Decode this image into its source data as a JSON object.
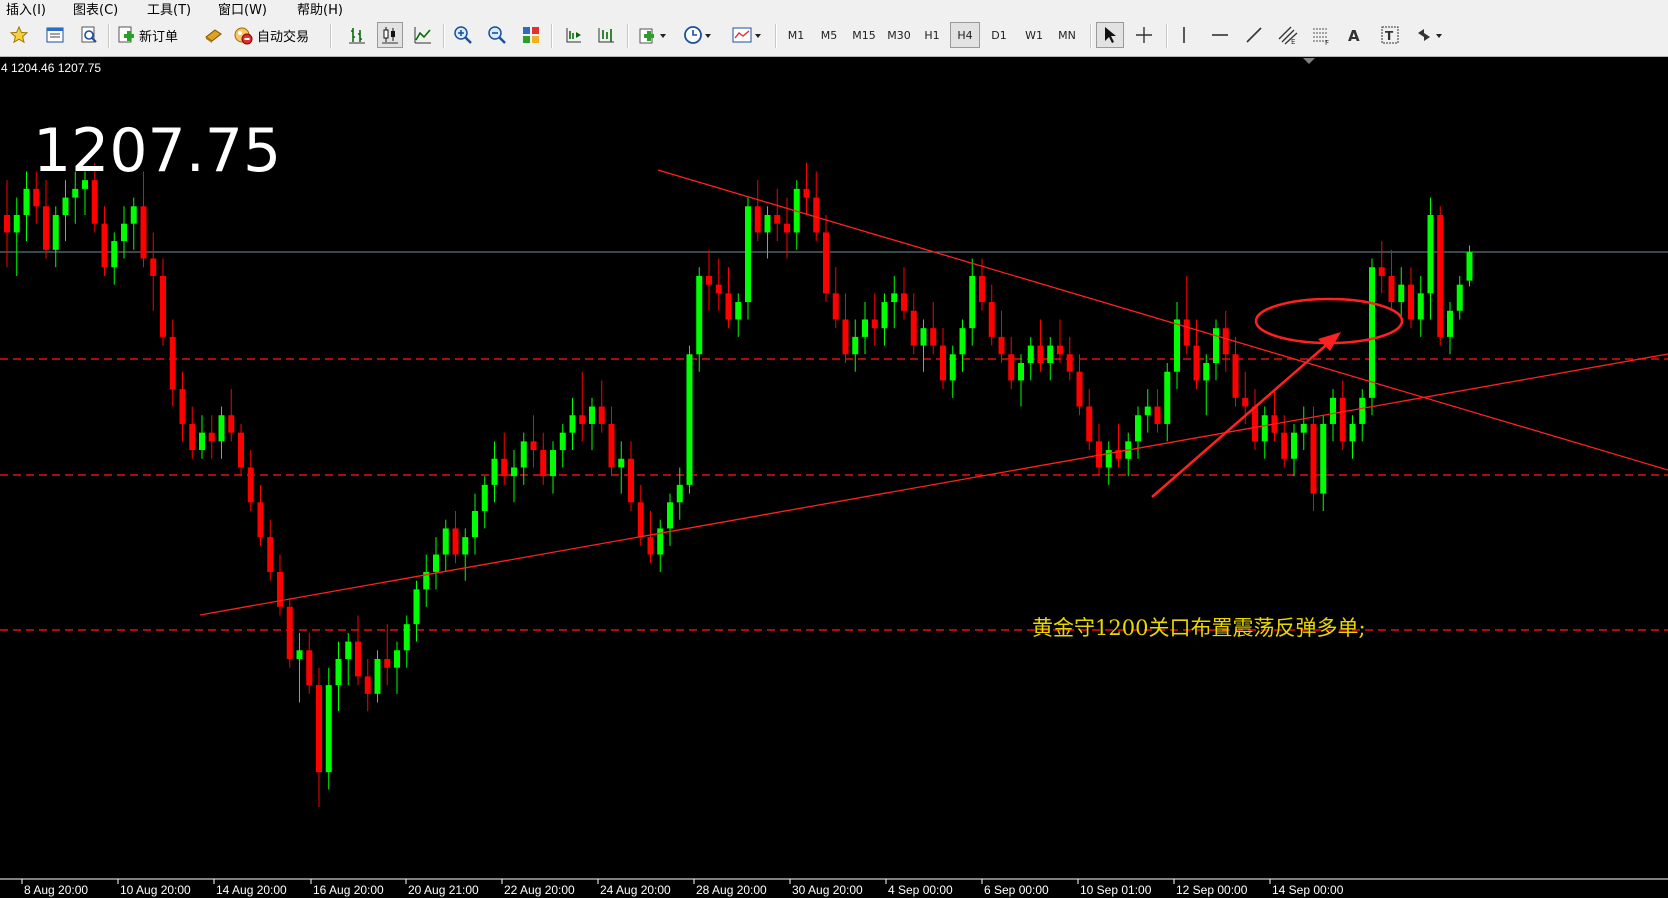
{
  "menu": {
    "items": [
      {
        "label": "插入(I)"
      },
      {
        "label": "图表(C)"
      },
      {
        "label": "工具(T)"
      },
      {
        "label": "窗口(W)"
      },
      {
        "label": "帮助(H)"
      }
    ]
  },
  "toolbar": {
    "new_order_label": "新订单",
    "auto_trading_label": "自动交易",
    "timeframes": [
      "M1",
      "M5",
      "M15",
      "M30",
      "H1",
      "H4",
      "D1",
      "W1",
      "MN"
    ],
    "active_timeframe": "H4"
  },
  "chart_header": {
    "ohlc_text": "4 1204.46 1207.75"
  },
  "price_display": "1207.75",
  "annotation": {
    "text": "黄金守1200关口布置震荡反弹多单;"
  },
  "colors": {
    "background": "#000000",
    "bull_candle": "#00ff00",
    "bear_candle": "#ff0000",
    "trend_line": "#ff2020",
    "bid_line": "#6f8f99",
    "annotation_text": "#e8d800"
  },
  "chart_data": {
    "type": "candlestick",
    "x_tick_labels": [
      "8 Aug 20:00",
      "10 Aug 20:00",
      "14 Aug 20:00",
      "16 Aug 20:00",
      "20 Aug 21:00",
      "22 Aug 20:00",
      "24 Aug 20:00",
      "28 Aug 20:00",
      "30 Aug 20:00",
      "4 Sep 00:00",
      "6 Sep 00:00",
      "10 Sep 01:00",
      "12 Sep 00:00",
      "14 Sep 00:00"
    ],
    "last_price": 1207.75,
    "horizontal_levels_dashed": 3,
    "candles": [
      [
        1212,
        1216,
        1206,
        1210
      ],
      [
        1210,
        1214,
        1205,
        1212
      ],
      [
        1212,
        1217,
        1209,
        1215
      ],
      [
        1215,
        1217,
        1211,
        1213
      ],
      [
        1213,
        1216,
        1207,
        1208
      ],
      [
        1208,
        1213,
        1206,
        1212
      ],
      [
        1212,
        1216,
        1209,
        1214
      ],
      [
        1214,
        1217,
        1211,
        1215
      ],
      [
        1215,
        1217,
        1212,
        1216
      ],
      [
        1216,
        1218,
        1210,
        1211
      ],
      [
        1211,
        1213,
        1205,
        1206
      ],
      [
        1206,
        1210,
        1204,
        1209
      ],
      [
        1209,
        1213,
        1207,
        1211
      ],
      [
        1211,
        1214,
        1208,
        1213
      ],
      [
        1213,
        1217,
        1206,
        1207
      ],
      [
        1207,
        1210,
        1201,
        1205
      ],
      [
        1205,
        1207,
        1197,
        1198
      ],
      [
        1198,
        1200,
        1190,
        1192
      ],
      [
        1192,
        1194,
        1186,
        1188
      ],
      [
        1188,
        1190,
        1184,
        1185
      ],
      [
        1185,
        1189,
        1184,
        1187
      ],
      [
        1187,
        1189,
        1184,
        1186
      ],
      [
        1186,
        1190,
        1184,
        1189
      ],
      [
        1189,
        1192,
        1186,
        1187
      ],
      [
        1187,
        1188,
        1182,
        1183
      ],
      [
        1183,
        1185,
        1178,
        1179
      ],
      [
        1179,
        1181,
        1174,
        1175
      ],
      [
        1175,
        1177,
        1170,
        1171
      ],
      [
        1171,
        1173,
        1166,
        1167
      ],
      [
        1167,
        1168,
        1160,
        1161
      ],
      [
        1161,
        1164,
        1156,
        1162
      ],
      [
        1162,
        1164,
        1157,
        1158
      ],
      [
        1158,
        1160,
        1144,
        1148
      ],
      [
        1148,
        1160,
        1146,
        1158
      ],
      [
        1158,
        1163,
        1155,
        1161
      ],
      [
        1161,
        1164,
        1158,
        1163
      ],
      [
        1163,
        1166,
        1158,
        1159
      ],
      [
        1159,
        1161,
        1155,
        1157
      ],
      [
        1157,
        1162,
        1156,
        1161
      ],
      [
        1161,
        1165,
        1158,
        1160
      ],
      [
        1160,
        1163,
        1157,
        1162
      ],
      [
        1162,
        1166,
        1160,
        1165
      ],
      [
        1165,
        1170,
        1163,
        1169
      ],
      [
        1169,
        1173,
        1167,
        1171
      ],
      [
        1171,
        1175,
        1169,
        1173
      ],
      [
        1173,
        1177,
        1171,
        1176
      ],
      [
        1176,
        1178,
        1172,
        1173
      ],
      [
        1173,
        1176,
        1170,
        1175
      ],
      [
        1175,
        1180,
        1173,
        1178
      ],
      [
        1178,
        1182,
        1176,
        1181
      ],
      [
        1181,
        1186,
        1179,
        1184
      ],
      [
        1184,
        1187,
        1181,
        1182
      ],
      [
        1182,
        1185,
        1179,
        1183
      ],
      [
        1183,
        1187,
        1181,
        1186
      ],
      [
        1186,
        1189,
        1183,
        1185
      ],
      [
        1185,
        1187,
        1181,
        1182
      ],
      [
        1182,
        1186,
        1180,
        1185
      ],
      [
        1185,
        1188,
        1183,
        1187
      ],
      [
        1187,
        1191,
        1185,
        1189
      ],
      [
        1189,
        1194,
        1186,
        1188
      ],
      [
        1188,
        1191,
        1185,
        1190
      ],
      [
        1190,
        1193,
        1187,
        1188
      ],
      [
        1188,
        1190,
        1182,
        1183
      ],
      [
        1183,
        1186,
        1180,
        1184
      ],
      [
        1184,
        1186,
        1178,
        1179
      ],
      [
        1179,
        1181,
        1174,
        1175
      ],
      [
        1175,
        1178,
        1172,
        1173
      ],
      [
        1173,
        1177,
        1171,
        1176
      ],
      [
        1176,
        1180,
        1174,
        1179
      ],
      [
        1179,
        1183,
        1177,
        1181
      ],
      [
        1181,
        1197,
        1180,
        1196
      ],
      [
        1196,
        1206,
        1194,
        1205
      ],
      [
        1205,
        1208,
        1201,
        1204
      ],
      [
        1204,
        1207,
        1201,
        1203
      ],
      [
        1203,
        1206,
        1199,
        1200
      ],
      [
        1200,
        1203,
        1198,
        1202
      ],
      [
        1202,
        1214,
        1200,
        1213
      ],
      [
        1213,
        1216,
        1209,
        1210
      ],
      [
        1210,
        1213,
        1207,
        1212
      ],
      [
        1212,
        1215,
        1209,
        1211
      ],
      [
        1211,
        1214,
        1207,
        1210
      ],
      [
        1210,
        1216,
        1208,
        1215
      ],
      [
        1215,
        1218,
        1212,
        1214
      ],
      [
        1214,
        1217,
        1209,
        1210
      ],
      [
        1210,
        1212,
        1202,
        1203
      ],
      [
        1203,
        1206,
        1199,
        1200
      ],
      [
        1200,
        1203,
        1195,
        1196
      ],
      [
        1196,
        1200,
        1194,
        1198
      ],
      [
        1198,
        1202,
        1196,
        1200
      ],
      [
        1200,
        1203,
        1197,
        1199
      ],
      [
        1199,
        1203,
        1197,
        1202
      ],
      [
        1202,
        1205,
        1199,
        1203
      ],
      [
        1203,
        1206,
        1200,
        1201
      ],
      [
        1201,
        1203,
        1196,
        1197
      ],
      [
        1197,
        1200,
        1194,
        1199
      ],
      [
        1199,
        1202,
        1196,
        1197
      ],
      [
        1197,
        1199,
        1192,
        1193
      ],
      [
        1193,
        1197,
        1191,
        1196
      ],
      [
        1196,
        1200,
        1194,
        1199
      ],
      [
        1199,
        1207,
        1197,
        1205
      ],
      [
        1205,
        1207,
        1201,
        1202
      ],
      [
        1202,
        1204,
        1197,
        1198
      ],
      [
        1198,
        1201,
        1195,
        1196
      ],
      [
        1196,
        1198,
        1192,
        1193
      ],
      [
        1193,
        1196,
        1190,
        1195
      ],
      [
        1195,
        1198,
        1193,
        1197
      ],
      [
        1197,
        1200,
        1194,
        1195
      ],
      [
        1195,
        1198,
        1193,
        1197
      ],
      [
        1197,
        1200,
        1195,
        1196
      ],
      [
        1196,
        1198,
        1193,
        1194
      ],
      [
        1194,
        1196,
        1189,
        1190
      ],
      [
        1190,
        1192,
        1185,
        1186
      ],
      [
        1186,
        1188,
        1182,
        1183
      ],
      [
        1183,
        1186,
        1181,
        1185
      ],
      [
        1185,
        1188,
        1183,
        1184
      ],
      [
        1184,
        1187,
        1182,
        1186
      ],
      [
        1186,
        1190,
        1184,
        1189
      ],
      [
        1189,
        1192,
        1187,
        1190
      ],
      [
        1190,
        1192,
        1187,
        1188
      ],
      [
        1188,
        1195,
        1186,
        1194
      ],
      [
        1194,
        1202,
        1192,
        1200
      ],
      [
        1200,
        1205,
        1196,
        1197
      ],
      [
        1197,
        1200,
        1192,
        1193
      ],
      [
        1193,
        1196,
        1189,
        1195
      ],
      [
        1195,
        1200,
        1193,
        1199
      ],
      [
        1199,
        1201,
        1194,
        1196
      ],
      [
        1196,
        1198,
        1190,
        1191
      ],
      [
        1191,
        1194,
        1188,
        1190
      ],
      [
        1190,
        1192,
        1185,
        1186
      ],
      [
        1186,
        1190,
        1184,
        1189
      ],
      [
        1189,
        1192,
        1186,
        1187
      ],
      [
        1187,
        1189,
        1183,
        1184
      ],
      [
        1184,
        1188,
        1182,
        1187
      ],
      [
        1187,
        1190,
        1185,
        1188
      ],
      [
        1188,
        1190,
        1178,
        1180
      ],
      [
        1180,
        1189,
        1178,
        1188
      ],
      [
        1188,
        1192,
        1186,
        1191
      ],
      [
        1191,
        1193,
        1185,
        1186
      ],
      [
        1186,
        1189,
        1184,
        1188
      ],
      [
        1188,
        1192,
        1186,
        1191
      ],
      [
        1191,
        1207,
        1189,
        1206
      ],
      [
        1206,
        1209,
        1203,
        1205
      ],
      [
        1205,
        1208,
        1201,
        1202
      ],
      [
        1202,
        1206,
        1200,
        1204
      ],
      [
        1204,
        1206,
        1199,
        1200
      ],
      [
        1200,
        1205,
        1198,
        1203
      ],
      [
        1203,
        1214,
        1200,
        1212
      ],
      [
        1212,
        1213,
        1197,
        1198
      ],
      [
        1198,
        1202,
        1196,
        1201
      ],
      [
        1201,
        1205,
        1200,
        1204
      ],
      [
        1204.46,
        1208.5,
        1203.8,
        1207.75
      ]
    ]
  }
}
